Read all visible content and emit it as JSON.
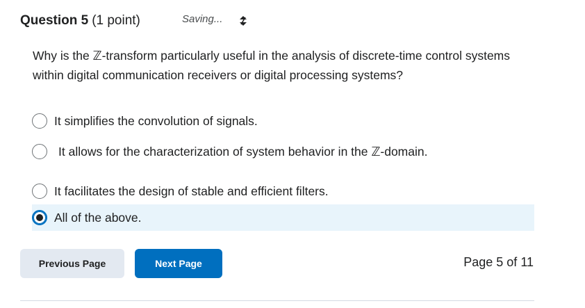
{
  "question": {
    "title": "Question 5",
    "points": "(1 point)",
    "status": "Saving...",
    "text": "Why is the ℤ-transform particularly useful in the analysis of discrete-time control systems within digital communication receivers or digital processing systems?"
  },
  "options": [
    {
      "label": "It simplifies the convolution of signals.",
      "selected": false
    },
    {
      "label": "It allows for the characterization of system behavior in the ℤ-domain.",
      "selected": false
    },
    {
      "label": "It facilitates the design of stable and efficient filters.",
      "selected": false
    },
    {
      "label": "All of the above.",
      "selected": true
    }
  ],
  "navigation": {
    "previous_label": "Previous Page",
    "next_label": "Next Page",
    "page_indicator": "Page 5 of 11"
  },
  "icons": {
    "status": "sync-icon",
    "radio": "radio-button-icon"
  },
  "colors": {
    "accent": "#006fbf",
    "selected_background": "#e8f4fb",
    "secondary_button": "#e3e9f1"
  }
}
